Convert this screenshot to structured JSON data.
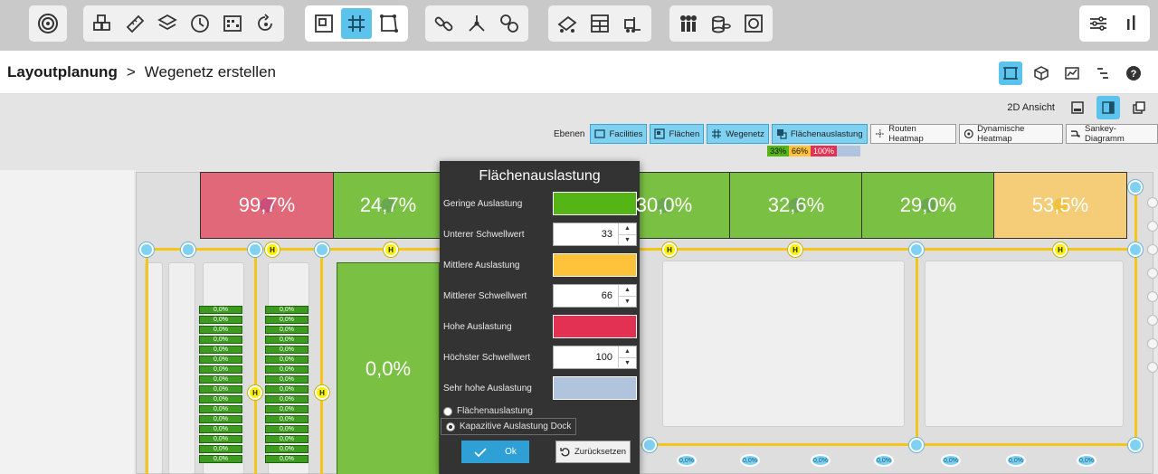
{
  "header": {
    "breadcrumb_root": "Layoutplanung",
    "breadcrumb_sep": ">",
    "breadcrumb_current": "Wegenetz erstellen"
  },
  "toolbar": {
    "groups": [
      [
        "radar-icon"
      ],
      [
        "boxes-icon",
        "ruler-icon",
        "layers-icon",
        "clock-icon",
        "grid-dots-icon",
        "refresh-search-icon"
      ],
      [
        "area-icon",
        "grid-icon",
        "polygon-icon"
      ],
      [
        "link-icon",
        "network-icon",
        "chain-icon"
      ],
      [
        "truck-loading-icon",
        "shelves-icon",
        "forklift-icon"
      ],
      [
        "people-icon",
        "coins-icon",
        "target-icon"
      ],
      [
        "sliders-icon",
        "bars-icon"
      ]
    ],
    "active": [
      "area-icon",
      "grid-icon",
      "polygon-icon"
    ]
  },
  "view": {
    "label": "2D Ansicht"
  },
  "layers": {
    "label": "Ebenen",
    "items": [
      {
        "label": "Facilities",
        "on": true
      },
      {
        "label": "Flächen",
        "on": true
      },
      {
        "label": "Wegenetz",
        "on": true
      },
      {
        "label": "Flächenauslastung",
        "on": true
      },
      {
        "label": "Routen Heatmap",
        "on": false
      },
      {
        "label": "Dynamische Heatmap",
        "on": false
      },
      {
        "label": "Sankey-Diagramm",
        "on": false
      }
    ]
  },
  "legend": {
    "low": "33%",
    "mid": "66%",
    "high": "100%",
    "colors": {
      "low": "#55b517",
      "mid": "#ffc23a",
      "high": "#e23152",
      "veryhigh": "#b0c4de"
    }
  },
  "zones": [
    {
      "label": "99,7%",
      "color": "#e06878"
    },
    {
      "label": "24,7%",
      "color": "#7ac143"
    },
    {
      "label": "30,0%",
      "color": "#7ac143"
    },
    {
      "label": "32,6%",
      "color": "#7ac143"
    },
    {
      "label": "29,0%",
      "color": "#7ac143"
    },
    {
      "label": "53,5%",
      "color": "#f5cd78"
    }
  ],
  "big_zone": {
    "label": "0,0%"
  },
  "rack_value": "0,0%",
  "popup": {
    "title": "Flächenauslastung",
    "low_label": "Geringe Auslastung",
    "lower_threshold_label": "Unterer Schwellwert",
    "lower_threshold": "33",
    "mid_label": "Mittlere Auslastung",
    "mid_threshold_label": "Mittlerer Schwellwert",
    "mid_threshold": "66",
    "high_label": "Hohe Auslastung",
    "max_threshold_label": "Höchster Schwellwert",
    "max_threshold": "100",
    "very_high_label": "Sehr hohe Auslastung",
    "radio_area": "Flächenauslastung",
    "radio_dock": "Kapazitive Auslastung Dock",
    "ok": "Ok",
    "reset": "Zurücksetzen"
  }
}
